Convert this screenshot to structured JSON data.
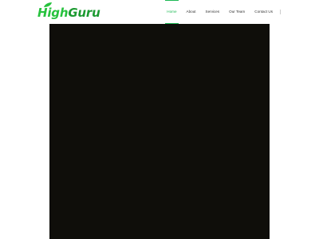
{
  "brand": {
    "logo_part_a": "High",
    "logo_part_b": "Guru",
    "logo_color": "#27c23e"
  },
  "nav": {
    "items": [
      {
        "label": "Home",
        "active": true
      },
      {
        "label": "About",
        "active": false
      },
      {
        "label": "Services",
        "active": false
      },
      {
        "label": "Our Team",
        "active": false
      },
      {
        "label": "Contact Us",
        "active": false
      }
    ],
    "active_color": "#1db954"
  },
  "hero": {
    "background": "#0f0e0a"
  }
}
